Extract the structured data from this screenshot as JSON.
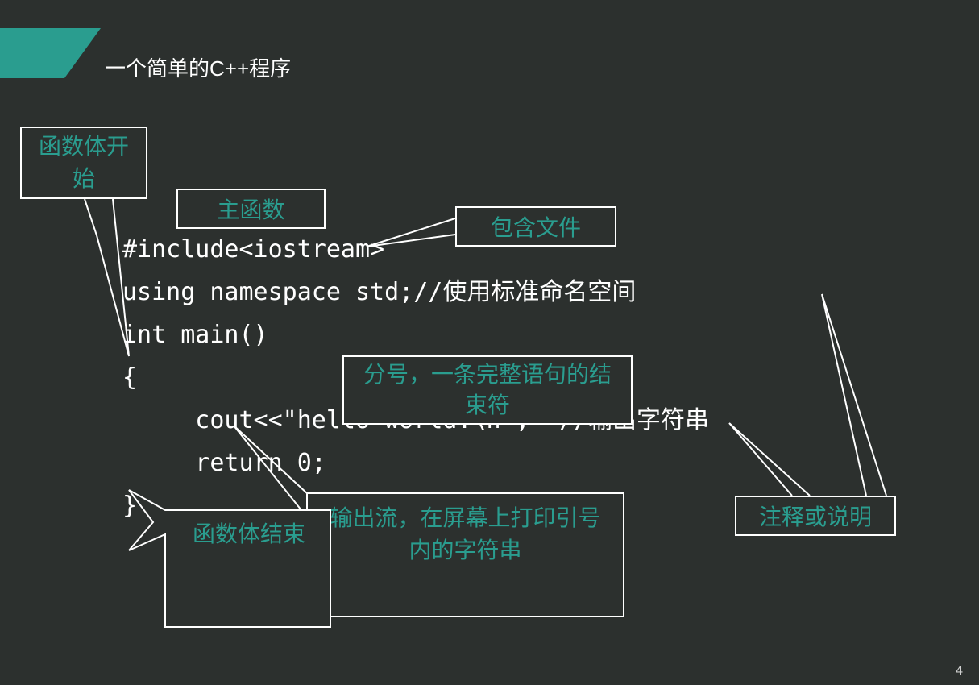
{
  "title": "一个简单的C++程序",
  "code": "#include<iostream>\nusing namespace std;//使用标准命名空间\nint main()\n{\n     cout<<\"hello world.\\n\";  //输出字符串\n     return 0;\n}",
  "callouts": {
    "func_begin": "函数体开\n始",
    "main_func": "主函数",
    "include_file": "包含文件",
    "semicolon": "分号，一条完整语句的结\n束符",
    "comment": "注释或说明",
    "cout": "输出流，在屏幕上打印引号\n内的字符串",
    "func_end": "函数体结束"
  },
  "page_number": "4",
  "colors": {
    "accent": "#2a9d8f",
    "bg": "#2c302e",
    "border": "#ffffff"
  }
}
